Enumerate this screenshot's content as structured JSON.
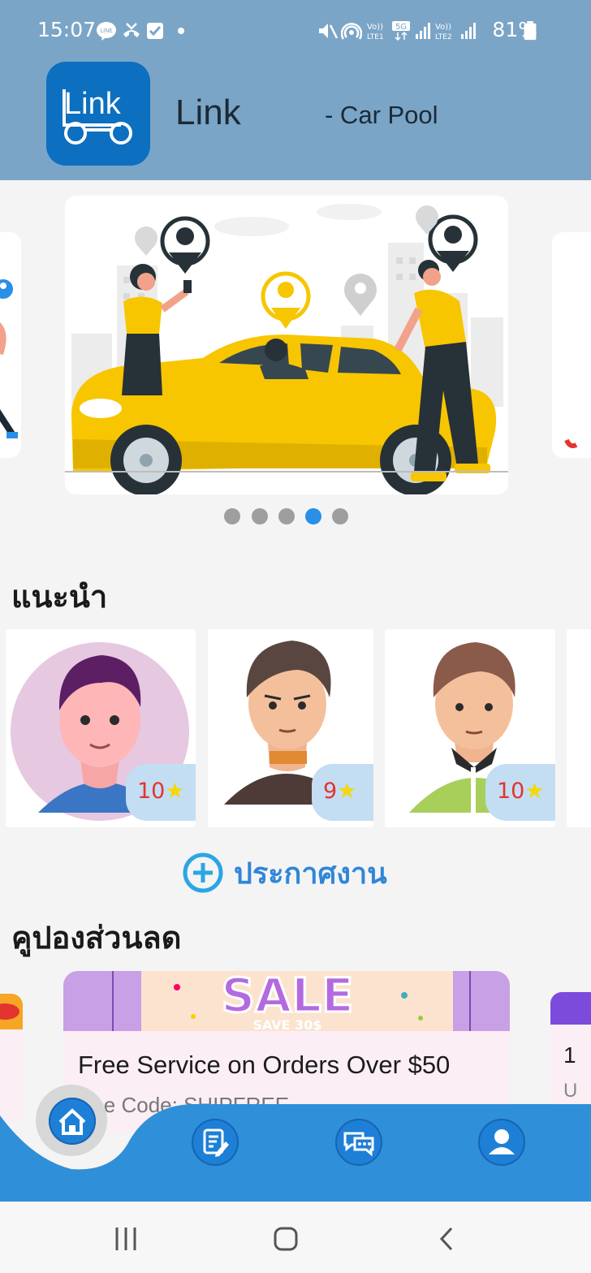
{
  "status_bar": {
    "time": "15:07",
    "battery": "81%",
    "network_labels": [
      "VoLTE1",
      "5G",
      "VoLTE2"
    ]
  },
  "header": {
    "logo_text": "Link",
    "title": "Link",
    "subtitle": "- Car Pool"
  },
  "carousel": {
    "slide_count": 5,
    "active_index": 3,
    "image_description_icon": "car-pool-illustration"
  },
  "recommend": {
    "title": "แนะนำ",
    "cards": [
      {
        "rating": "10",
        "avatar": "avatar-purple-hair"
      },
      {
        "rating": "9",
        "avatar": "avatar-brown-sweater"
      },
      {
        "rating": "10",
        "avatar": "avatar-green-shirt"
      }
    ]
  },
  "post_job": {
    "label": "ประกาศงาน",
    "icon": "plus-circle-icon"
  },
  "coupons": {
    "title": "คูปองส่วนลด",
    "items": [
      {
        "banner_text": "SALE",
        "banner_sub": "SAVE 30$",
        "title": "Free Service on Orders Over $50",
        "subtitle": "Use Code: SHIPFREE"
      }
    ],
    "peek_right": {
      "title": "1",
      "subtitle": "U"
    }
  },
  "bottom_nav": {
    "items": [
      {
        "name": "home",
        "icon": "home-icon"
      },
      {
        "name": "tasks",
        "icon": "edit-document-icon"
      },
      {
        "name": "chat",
        "icon": "chat-bubbles-icon"
      },
      {
        "name": "profile",
        "icon": "user-icon"
      }
    ],
    "active": "home"
  },
  "colors": {
    "header_bg": "#7ba5c7",
    "accent_blue": "#2a8fe6",
    "nav_bg": "#2f8fd8",
    "rating_text": "#e3342f",
    "rating_star": "#f3d80c",
    "car_yellow": "#f7c600"
  }
}
